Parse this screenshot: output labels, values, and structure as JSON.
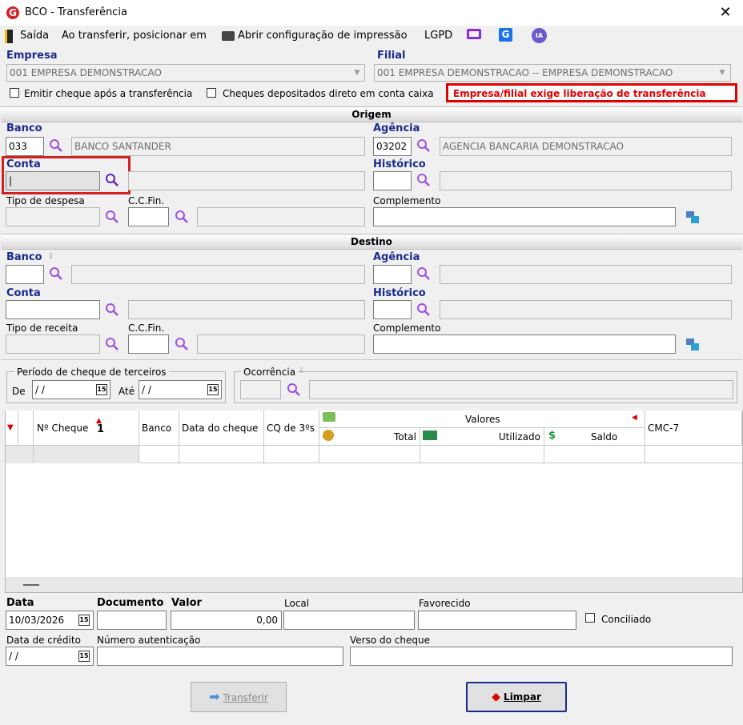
{
  "window": {
    "title": "BCO - Transferência"
  },
  "toolbar": {
    "exit": "Saída",
    "position": "Ao transferir, posicionar em",
    "print_config": "Abrir configuração de impressão",
    "lgpd": "LGPD",
    "ia": "IA"
  },
  "empresa": {
    "label": "Empresa",
    "value": "001 EMPRESA DEMONSTRACAO"
  },
  "filial": {
    "label": "Filial",
    "value": "001 EMPRESA DEMONSTRACAO -- EMPRESA DEMONSTRACAO"
  },
  "options": {
    "emitir": "Emitir cheque após a transferência",
    "depositados": "Cheques depositados direto em conta caixa"
  },
  "alert": "Empresa/filial exige liberação de transferência",
  "origem": {
    "title": "Origem",
    "banco_label": "Banco",
    "banco_code": "033",
    "banco_name": "BANCO SANTANDER",
    "agencia_label": "Agência",
    "agencia_code": "03202",
    "agencia_name": "AGENCIA BANCARIA DEMONSTRACAO",
    "conta_label": "Conta",
    "historico_label": "Histórico",
    "tipo_label": "Tipo de despesa",
    "ccfin_label": "C.C.Fin.",
    "complemento_label": "Complemento"
  },
  "destino": {
    "title": "Destino",
    "banco_label": "Banco",
    "agencia_label": "Agência",
    "conta_label": "Conta",
    "historico_label": "Histórico",
    "tipo_label": "Tipo de receita",
    "ccfin_label": "C.C.Fin.",
    "complemento_label": "Complemento"
  },
  "periodo": {
    "legend": "Período de cheque de terceiros",
    "de": "De",
    "ate": "Até",
    "de_value": " / /",
    "ate_value": " / /"
  },
  "ocorrencia": {
    "legend": "Ocorrência"
  },
  "grid": {
    "columns": [
      "Nº Cheque",
      "Banco",
      "Data do cheque",
      "CQ de 3ºs",
      "Valores",
      "Total",
      "Utilizado",
      "Saldo",
      "CMC-7"
    ],
    "sort_marker": "1"
  },
  "footer": {
    "data_label": "Data",
    "data_value": "10/03/2026",
    "documento_label": "Documento",
    "valor_label": "Valor",
    "valor_value": "0,00",
    "local_label": "Local",
    "favorecido_label": "Favorecido",
    "conciliado_label": "Conciliado",
    "credito_label": "Data de crédito",
    "credito_value": " / /",
    "autenticacao_label": "Número autenticação",
    "verso_label": "Verso do cheque"
  },
  "buttons": {
    "transferir": "Transferir",
    "limpar": "Limpar"
  },
  "colors": {
    "accent": "#1a2a8a",
    "alert": "#e00000",
    "highlight": "#d32020",
    "magnifier": "#a050e0"
  }
}
